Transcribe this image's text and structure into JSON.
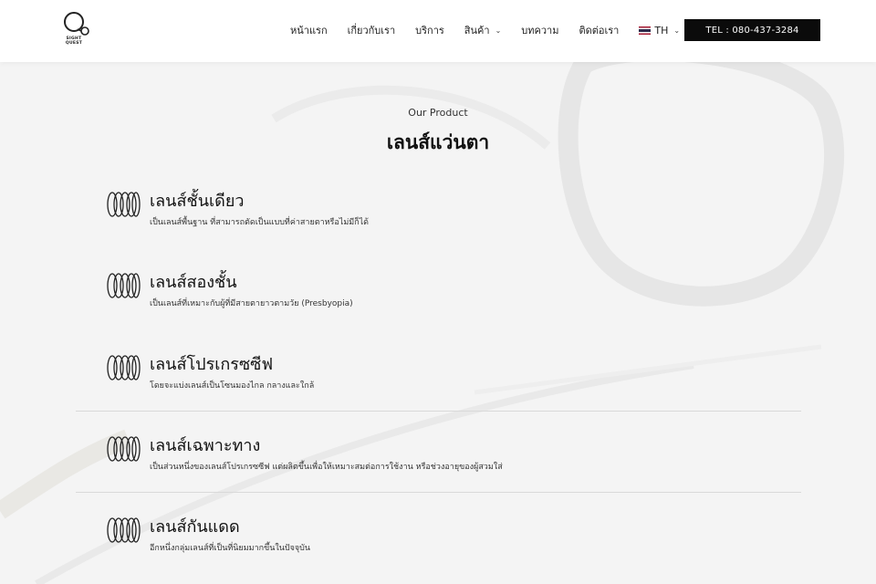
{
  "header": {
    "logo_lines": [
      "SIGHT",
      "QUEST"
    ],
    "nav": [
      {
        "label": "หน้าแรก",
        "has_dropdown": false
      },
      {
        "label": "เกี่ยวกับเรา",
        "has_dropdown": false
      },
      {
        "label": "บริการ",
        "has_dropdown": false
      },
      {
        "label": "สินค้า",
        "has_dropdown": true
      },
      {
        "label": "บทความ",
        "has_dropdown": false
      },
      {
        "label": "ติดต่อเรา",
        "has_dropdown": false
      }
    ],
    "language": {
      "label": "TH",
      "icon": "thai-flag-icon"
    },
    "tel_button": "TEL : 080-437-3284"
  },
  "section": {
    "eyebrow": "Our Product",
    "title": "เลนส์แว่นตา"
  },
  "products": [
    {
      "name": "เลนส์ชั้นเดียว",
      "description": "เป็นเลนส์พื้นฐาน ที่สามารถตัดเป็นแบบที่ค่าสายตาหรือไม่มีก็ได้",
      "icon": "lens-rings-icon"
    },
    {
      "name": "เลนส์สองชั้น",
      "description": "เป็นเลนส์ที่เหมาะกับผู้ที่มีสายตายาวตามวัย (Presbyopia)",
      "icon": "lens-rings-icon"
    },
    {
      "name": "เลนส์โปรเกรซซีฟ",
      "description": "โดยจะแบ่งเลนส์เป็นโซนมองไกล กลางและใกล้",
      "icon": "lens-rings-icon"
    },
    {
      "name": "เลนส์เฉพาะทาง",
      "description": "เป็นส่วนหนึ่งของเลนส์โปรเกรซซีฟ แต่ผลิตขึ้นเพื่อให้เหมาะสมต่อการใช้งาน หรือช่วงอายุของผู้สวมใส่",
      "icon": "lens-rings-icon"
    },
    {
      "name": "เลนส์กันแดด",
      "description": "อีกหนึ่งกลุ่มเลนส์ที่เป็นที่นิยมมากขึ้นในปัจจุบัน",
      "icon": "lens-rings-icon"
    }
  ],
  "colors": {
    "background": "#f4f4f4",
    "header": "#ffffff",
    "tel_button_bg": "#0b0b0b",
    "text": "#111111"
  }
}
